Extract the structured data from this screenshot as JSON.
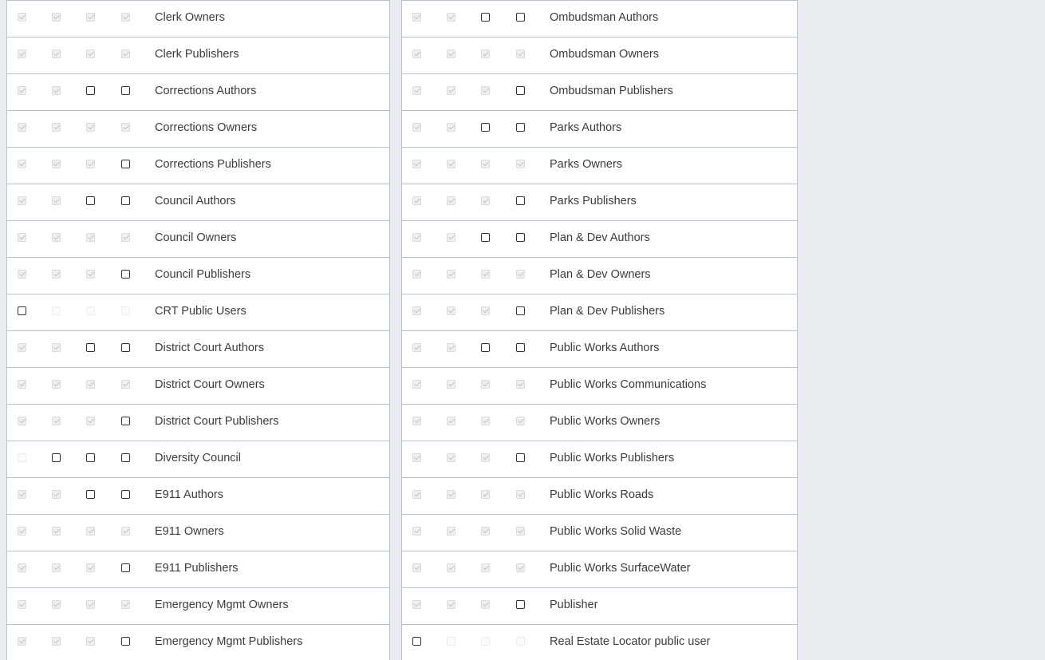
{
  "left_rows": [
    {
      "label": "Clerk Owners",
      "checks": [
        "checked",
        "checked",
        "checked",
        "checked"
      ]
    },
    {
      "label": "Clerk Publishers",
      "checks": [
        "checked",
        "checked",
        "checked",
        "checked"
      ]
    },
    {
      "label": "Corrections Authors",
      "checks": [
        "checked",
        "checked",
        "unchecked",
        "unchecked"
      ]
    },
    {
      "label": "Corrections Owners",
      "checks": [
        "checked",
        "checked",
        "checked",
        "checked"
      ]
    },
    {
      "label": "Corrections Publishers",
      "checks": [
        "checked",
        "checked",
        "checked",
        "unchecked"
      ]
    },
    {
      "label": "Council Authors",
      "checks": [
        "checked",
        "checked",
        "unchecked",
        "unchecked"
      ]
    },
    {
      "label": "Council Owners",
      "checks": [
        "checked",
        "checked",
        "checked",
        "checked"
      ]
    },
    {
      "label": "Council Publishers",
      "checks": [
        "checked",
        "checked",
        "checked",
        "unchecked"
      ]
    },
    {
      "label": "CRT Public Users",
      "checks": [
        "unchecked",
        "disabled-empty",
        "disabled-empty",
        "disabled-empty"
      ]
    },
    {
      "label": "District Court Authors",
      "checks": [
        "checked",
        "checked",
        "unchecked",
        "unchecked"
      ]
    },
    {
      "label": "District Court Owners",
      "checks": [
        "checked",
        "checked",
        "checked",
        "checked"
      ]
    },
    {
      "label": "District Court Publishers",
      "checks": [
        "checked",
        "checked",
        "checked",
        "unchecked"
      ]
    },
    {
      "label": "Diversity Council",
      "checks": [
        "disabled-empty",
        "unchecked",
        "unchecked",
        "unchecked"
      ]
    },
    {
      "label": "E911 Authors",
      "checks": [
        "checked",
        "checked",
        "unchecked",
        "unchecked"
      ]
    },
    {
      "label": "E911 Owners",
      "checks": [
        "checked",
        "checked",
        "checked",
        "checked"
      ]
    },
    {
      "label": "E911 Publishers",
      "checks": [
        "checked",
        "checked",
        "checked",
        "unchecked"
      ]
    },
    {
      "label": "Emergency Mgmt Owners",
      "checks": [
        "checked",
        "checked",
        "checked",
        "checked"
      ]
    },
    {
      "label": "Emergency Mgmt Publishers",
      "checks": [
        "checked",
        "checked",
        "checked",
        "unchecked"
      ]
    }
  ],
  "right_rows": [
    {
      "label": "Ombudsman Authors",
      "checks": [
        "checked",
        "checked",
        "unchecked",
        "unchecked"
      ]
    },
    {
      "label": "Ombudsman Owners",
      "checks": [
        "checked",
        "checked",
        "checked",
        "checked"
      ]
    },
    {
      "label": "Ombudsman Publishers",
      "checks": [
        "checked",
        "checked",
        "checked",
        "unchecked"
      ]
    },
    {
      "label": "Parks Authors",
      "checks": [
        "checked",
        "checked",
        "unchecked",
        "unchecked"
      ]
    },
    {
      "label": "Parks Owners",
      "checks": [
        "checked",
        "checked",
        "checked",
        "checked"
      ]
    },
    {
      "label": "Parks Publishers",
      "checks": [
        "checked",
        "checked",
        "checked",
        "unchecked"
      ]
    },
    {
      "label": "Plan & Dev Authors",
      "checks": [
        "checked",
        "checked",
        "unchecked",
        "unchecked"
      ]
    },
    {
      "label": "Plan & Dev Owners",
      "checks": [
        "checked",
        "checked",
        "checked",
        "checked"
      ]
    },
    {
      "label": "Plan & Dev Publishers",
      "checks": [
        "checked",
        "checked",
        "checked",
        "unchecked"
      ]
    },
    {
      "label": "Public Works Authors",
      "checks": [
        "checked",
        "checked",
        "unchecked",
        "unchecked"
      ]
    },
    {
      "label": "Public Works Communications",
      "checks": [
        "checked",
        "checked",
        "checked",
        "checked"
      ]
    },
    {
      "label": "Public Works Owners",
      "checks": [
        "checked",
        "checked",
        "checked",
        "checked"
      ]
    },
    {
      "label": "Public Works Publishers",
      "checks": [
        "checked",
        "checked",
        "checked",
        "unchecked"
      ]
    },
    {
      "label": "Public Works Roads",
      "checks": [
        "checked",
        "checked",
        "checked",
        "checked"
      ]
    },
    {
      "label": "Public Works Solid Waste",
      "checks": [
        "checked",
        "checked",
        "checked",
        "checked"
      ]
    },
    {
      "label": "Public Works SurfaceWater",
      "checks": [
        "checked",
        "checked",
        "checked",
        "checked"
      ]
    },
    {
      "label": "Publisher",
      "checks": [
        "checked",
        "checked",
        "checked",
        "unchecked"
      ]
    },
    {
      "label": "Real Estate Locator public user",
      "checks": [
        "unchecked",
        "disabled-empty",
        "disabled-empty",
        "disabled-empty"
      ]
    }
  ]
}
